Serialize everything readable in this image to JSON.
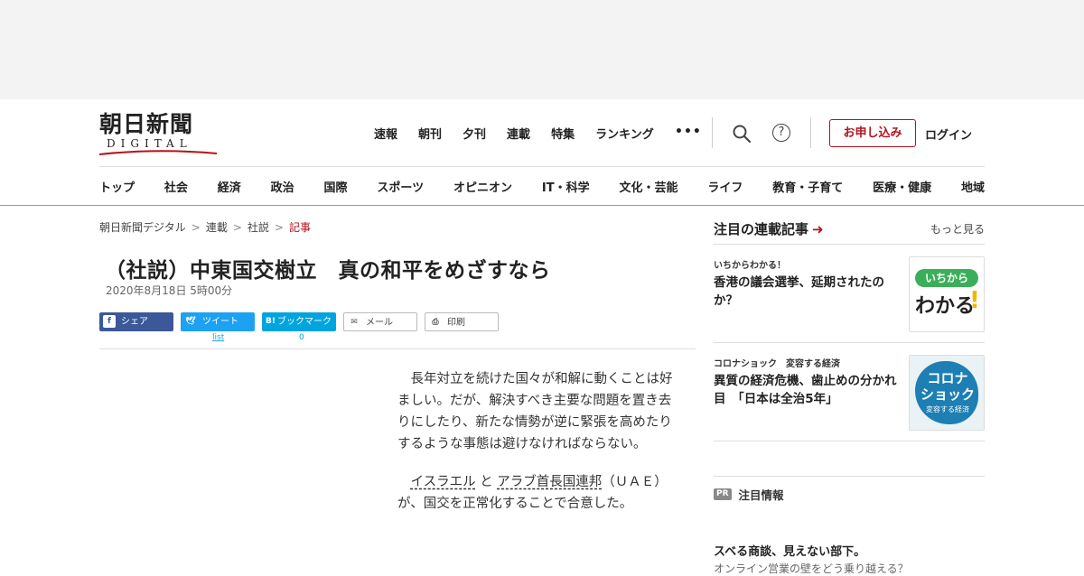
{
  "header": {
    "logo_text": "朝日新聞",
    "logo_sub": "DIGITAL",
    "top_nav": [
      "速報",
      "朝刊",
      "夕刊",
      "連載",
      "特集",
      "ランキング"
    ],
    "more_glyph": "•••",
    "help_glyph": "?",
    "apply_label": "お申し込み",
    "login_label": "ログイン",
    "categories": [
      "トップ",
      "社会",
      "経済",
      "政治",
      "国際",
      "スポーツ",
      "オピニオン",
      "IT・科学",
      "文化・芸能",
      "ライフ",
      "教育・子育て",
      "医療・健康",
      "地域"
    ]
  },
  "breadcrumb": [
    "朝日新聞デジタル",
    "連載",
    "社説",
    "記事"
  ],
  "article": {
    "title": "（社説）中東国交樹立　真の和平をめざすなら",
    "date": "2020年8月18日 5時00分",
    "share": {
      "facebook": "シェア",
      "twitter": "ツイート",
      "hatena": "ブックマーク",
      "mail": "メール",
      "print": "印刷",
      "twitter_count": "list",
      "hatena_count": "0"
    },
    "paragraph1": "長年対立を続けた国々が和解に動くことは好ましい。だが、解決すべき主要な問題を置き去りにしたり、新たな情勢が逆に緊張を高めたりするような事態は避けなければならない。",
    "p2_link1": "イスラエル",
    "p2_and": "と",
    "p2_link2": "アラブ首長国連邦",
    "p2_rest": "（ＵＡＥ）が、国交を正常化することで合意した。"
  },
  "sidebar": {
    "title": "注目の連載記事",
    "more": "もっと見る",
    "cards": [
      {
        "kicker": "いちからわかる！",
        "headline": "香港の議会選挙、延期されたのか？",
        "thumb_tag": "いちから",
        "thumb_big": "わかる",
        "thumb_bang": "!"
      },
      {
        "kicker": "コロナショック　変容する経済",
        "headline": "異質の経済危機、歯止めの分かれ目　「日本は全治5年」",
        "thumb_line1": "コロナ",
        "thumb_line2": "ショック",
        "thumb_line3": "変容する経済"
      }
    ],
    "pr_badge": "PR",
    "pr_label": "注目情報",
    "pr_headline": "スベる商談、見えない部下。",
    "pr_sub": "オンライン営業の壁をどう乗り越える？"
  }
}
